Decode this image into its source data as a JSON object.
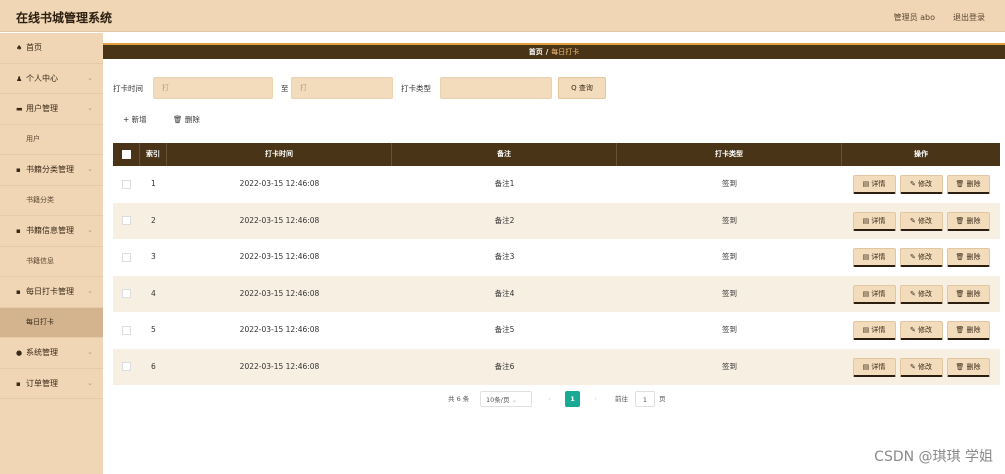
{
  "app": {
    "title": "在线书城管理系统"
  },
  "header": {
    "admin": "管理员 abo",
    "logout": "退出登录"
  },
  "sidebar": {
    "items": [
      {
        "type": "item",
        "icon": "home-icon",
        "glyph": "♠",
        "label": "首页",
        "chevron": false
      },
      {
        "type": "item",
        "icon": "user-icon",
        "glyph": "♟",
        "label": "个人中心",
        "chevron": true
      },
      {
        "type": "item",
        "icon": "users-icon",
        "glyph": "▬",
        "label": "用户管理",
        "chevron": true
      },
      {
        "type": "sub",
        "label": "用户",
        "active": false
      },
      {
        "type": "item",
        "icon": "grid-icon",
        "glyph": "▪",
        "label": "书籍分类管理",
        "chevron": true
      },
      {
        "type": "sub",
        "label": "书籍分类",
        "active": false
      },
      {
        "type": "item",
        "icon": "grid-icon",
        "glyph": "▪",
        "label": "书籍信息管理",
        "chevron": true
      },
      {
        "type": "sub",
        "label": "书籍信息",
        "active": false
      },
      {
        "type": "item",
        "icon": "grid-icon",
        "glyph": "▪",
        "label": "每日打卡管理",
        "chevron": true
      },
      {
        "type": "sub",
        "label": "每日打卡",
        "active": true
      },
      {
        "type": "item",
        "icon": "gear-icon",
        "glyph": "●",
        "label": "系统管理",
        "chevron": true
      },
      {
        "type": "item",
        "icon": "grid-icon",
        "glyph": "▪",
        "label": "订单管理",
        "chevron": true
      }
    ]
  },
  "breadcrumb": {
    "home": "首页",
    "sep": "/",
    "current": "每日打卡"
  },
  "search": {
    "time_label": "打卡时间",
    "time_from_placeholder": "打",
    "to_label": "至",
    "time_to_placeholder": "打",
    "type_label": "打卡类型",
    "type_placeholder": "",
    "search_button": "Q 查询"
  },
  "actions": {
    "add": "+ 新增",
    "delete": "🗑 删除"
  },
  "table": {
    "headers": {
      "index": "索引",
      "time": "打卡时间",
      "note": "备注",
      "type": "打卡类型",
      "ops": "操作"
    },
    "rows": [
      {
        "index": "1",
        "time": "2022-03-15 12:46:08",
        "note": "备注1",
        "type": "签到"
      },
      {
        "index": "2",
        "time": "2022-03-15 12:46:08",
        "note": "备注2",
        "type": "签到"
      },
      {
        "index": "3",
        "time": "2022-03-15 12:46:08",
        "note": "备注3",
        "type": "签到"
      },
      {
        "index": "4",
        "time": "2022-03-15 12:46:08",
        "note": "备注4",
        "type": "签到"
      },
      {
        "index": "5",
        "time": "2022-03-15 12:46:08",
        "note": "备注5",
        "type": "签到"
      },
      {
        "index": "6",
        "time": "2022-03-15 12:46:08",
        "note": "备注6",
        "type": "签到"
      }
    ],
    "op_labels": {
      "detail": "▤ 详情",
      "edit": "✎ 修改",
      "delete": "🗑 删除"
    }
  },
  "pagination": {
    "total": "共 6 条",
    "page_size": "10条/页",
    "page_size_caret": "⌄",
    "prev": "‹",
    "current_page": "1",
    "next": "›",
    "goto_label": "前往",
    "goto_value": "1",
    "page_suffix": "页"
  },
  "watermark": "CSDN @琪琪 学姐",
  "colors": {
    "sidebar_bg": "#f0d6b4",
    "header_dark": "#4a3418",
    "accent": "#e0a040",
    "page_active": "#1aa994"
  }
}
